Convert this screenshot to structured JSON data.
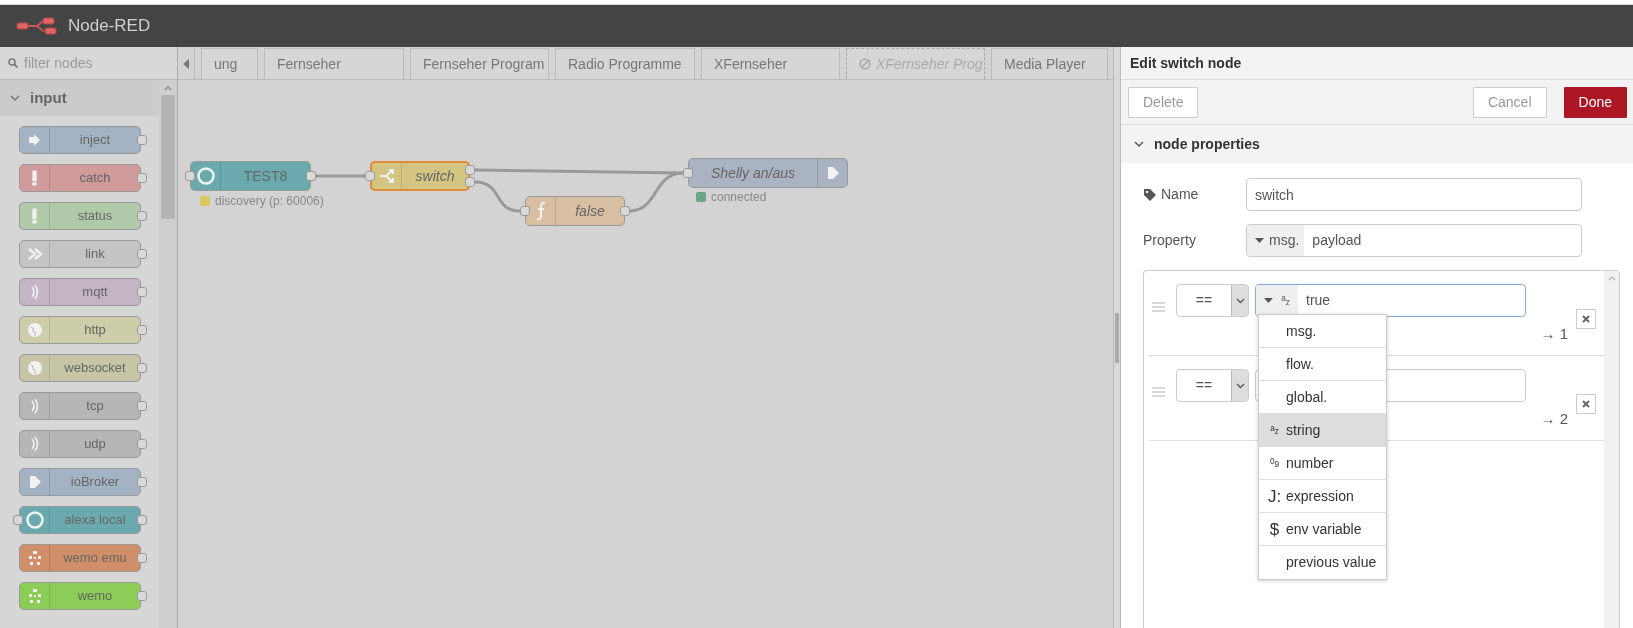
{
  "header": {
    "title": "Node-RED"
  },
  "palette": {
    "filter": {
      "placeholder": "filter nodes"
    },
    "category": {
      "label": "input",
      "expanded": true
    },
    "nodes": [
      {
        "label": "inject",
        "color": "#a3b3c3",
        "kind": "inject",
        "has_input": false
      },
      {
        "label": "catch",
        "color": "#d29b9b",
        "kind": "alert",
        "has_input": false
      },
      {
        "label": "status",
        "color": "#b0c9a9",
        "kind": "alert",
        "has_input": false
      },
      {
        "label": "link",
        "color": "#c4c4c4",
        "kind": "link",
        "has_input": false
      },
      {
        "label": "mqtt",
        "color": "#c4b5c5",
        "kind": "wave",
        "has_input": false
      },
      {
        "label": "http",
        "color": "#cdcda9",
        "kind": "globe",
        "has_input": false
      },
      {
        "label": "websocket",
        "color": "#c6c5a5",
        "kind": "globe",
        "has_input": false
      },
      {
        "label": "tcp",
        "color": "#b6b6b6",
        "kind": "wave",
        "has_input": false
      },
      {
        "label": "udp",
        "color": "#b6b6b6",
        "kind": "wave",
        "has_input": false
      },
      {
        "label": "ioBroker",
        "color": "#a3b3c3",
        "kind": "arrow",
        "has_input": false
      },
      {
        "label": "alexa local",
        "color": "#6aaaae",
        "kind": "ring",
        "has_input": true
      },
      {
        "label": "wemo emu",
        "color": "#d08f68",
        "kind": "dots",
        "has_input": false
      },
      {
        "label": "wemo",
        "color": "#8ccd57",
        "kind": "dots",
        "has_input": false
      }
    ]
  },
  "tabs": [
    {
      "label": "ung",
      "disabled": false
    },
    {
      "label": "Fernseher",
      "disabled": false
    },
    {
      "label": "Fernseher Program",
      "disabled": false
    },
    {
      "label": "Radio Programme",
      "disabled": false
    },
    {
      "label": "XFernseher",
      "disabled": false
    },
    {
      "label": "XFernseher Prog",
      "disabled": true
    },
    {
      "label": "Media Player",
      "disabled": false
    }
  ],
  "flow": {
    "nodes": [
      {
        "label": "TEST8",
        "kind": "ring",
        "color": "#6aaaae",
        "italic": false,
        "selected": false,
        "status": {
          "text": "discovery (p: 60006)",
          "color": "#d8c95a"
        }
      },
      {
        "label": "switch",
        "kind": "switch",
        "color": "#d4c680",
        "italic": true,
        "selected": true
      },
      {
        "label": "false",
        "kind": "function",
        "color": "#d9bfa2",
        "italic": true,
        "selected": false
      },
      {
        "label": "Shelly an/aus",
        "kind": "output",
        "color": "#a9b3c1",
        "italic": true,
        "selected": false,
        "status": {
          "text": "connected",
          "color": "#6aa58c"
        }
      }
    ]
  },
  "editor": {
    "title": "Edit switch node",
    "buttons": [
      {
        "label": "Delete",
        "kind": "plain"
      },
      {
        "label": "Cancel",
        "kind": "plain"
      },
      {
        "label": "Done",
        "kind": "primary"
      }
    ],
    "section": {
      "label": "node properties",
      "expanded": true
    },
    "fields": [
      {
        "label": "Name",
        "kind": "text",
        "value": "switch"
      },
      {
        "label": "Property",
        "kind": "typed",
        "type": "msg.",
        "value": "payload"
      }
    ],
    "rules": [
      {
        "operator": "==",
        "type_icon": "$^{a}$$_{z}$",
        "value": "true",
        "focused": true,
        "output": "→ 1"
      },
      {
        "operator": "==",
        "focused": false,
        "output": "→ 2"
      }
    ],
    "type_menu": [
      {
        "label": "msg.",
        "selected": false
      },
      {
        "label": "flow.",
        "selected": false
      },
      {
        "label": "global.",
        "selected": false
      },
      {
        "label": "string",
        "icon": "$^{a}$$_{z}$",
        "selected": true
      },
      {
        "label": "number",
        "icon": "$^{0}$$_{9}$",
        "selected": false
      },
      {
        "label": "expression",
        "icon": "J:",
        "selected": false
      },
      {
        "label": "env variable",
        "icon": "$",
        "selected": false
      },
      {
        "label": "previous value",
        "selected": false
      }
    ]
  }
}
